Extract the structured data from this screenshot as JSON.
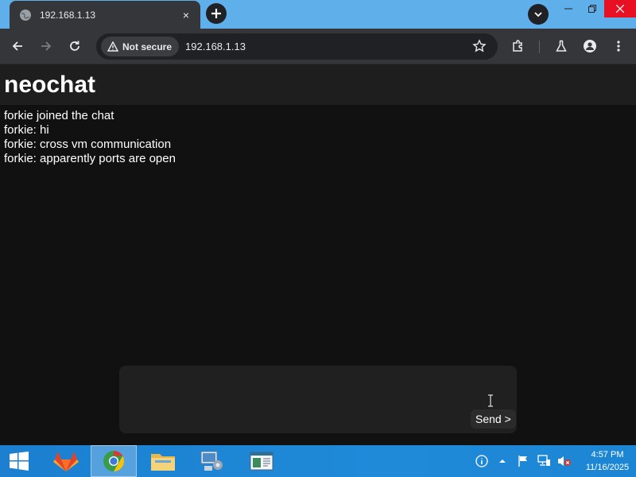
{
  "browser": {
    "tab_title": "192.168.1.13",
    "tab_close": "×",
    "security_label": "Not secure",
    "url": "192.168.1.13"
  },
  "page": {
    "title": "neochat",
    "messages": [
      "forkie joined the chat",
      "forkie: hi",
      "forkie: cross vm communication",
      "forkie: apparently ports are open"
    ],
    "composer_value": "",
    "send_label": "Send >"
  },
  "taskbar": {
    "time": "4:57 PM",
    "date": "11/16/2025",
    "items": [
      "start-button",
      "gitlab-app",
      "chrome-app",
      "file-explorer-app",
      "control-panel-app",
      "notepad-app"
    ]
  },
  "colors": {
    "accent_taskbar": "#1e8ad8",
    "titlebar": "#5fb0ea",
    "page_bg": "#111111"
  }
}
